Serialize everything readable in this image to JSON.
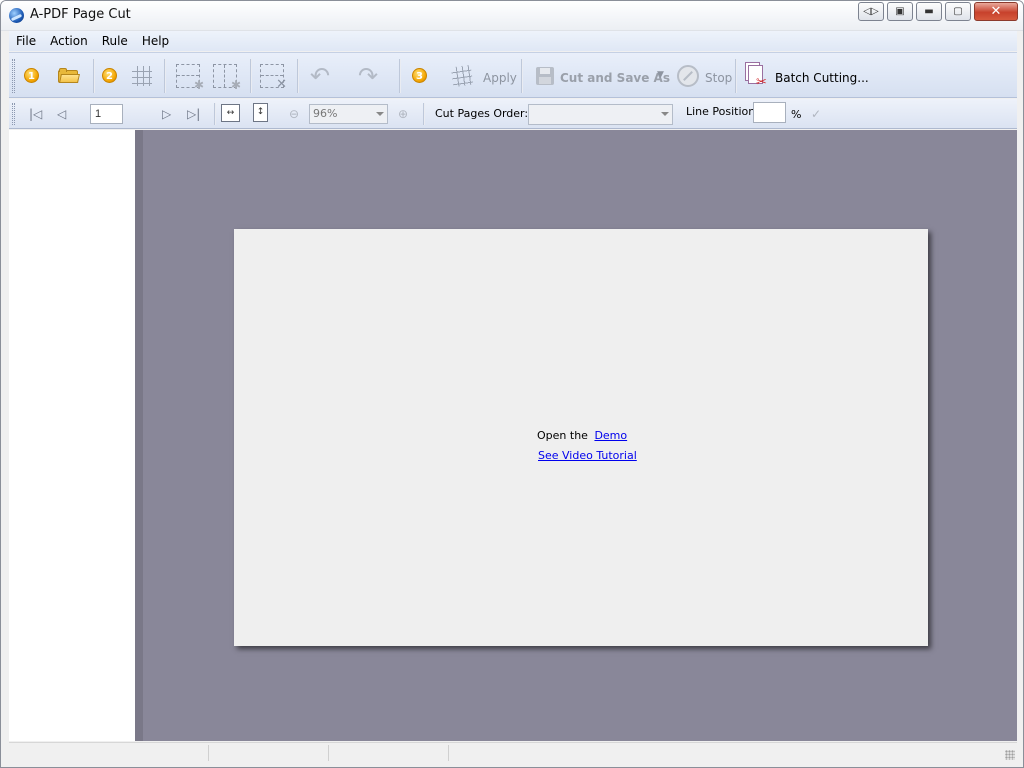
{
  "window": {
    "title": "A-PDF Page Cut"
  },
  "menu": [
    "File",
    "Action",
    "Rule",
    "Help"
  ],
  "toolbar": {
    "step1": "1",
    "step2": "2",
    "step3": "3",
    "apply_label": "Apply",
    "cut_save_label": "Cut and Save As",
    "stop_label": "Stop",
    "batch_label": "Batch Cutting..."
  },
  "navbar": {
    "page_value": "1",
    "zoom_value": "96%",
    "cut_order_label": "Cut Pages Order:",
    "cut_order_value": "",
    "line_position_label": "Line Position:",
    "line_position_value": "",
    "percent_sign": "%"
  },
  "content": {
    "open_prefix": "Open the",
    "demo_link": "Demo",
    "video_link": "See Video Tutorial"
  },
  "icons": {
    "open": "folder-open-icon",
    "grid": "grid-icon",
    "undo": "undo-icon",
    "redo": "redo-icon",
    "save": "disk-icon",
    "stop": "stop-icon",
    "batch": "batch-cut-icon"
  }
}
